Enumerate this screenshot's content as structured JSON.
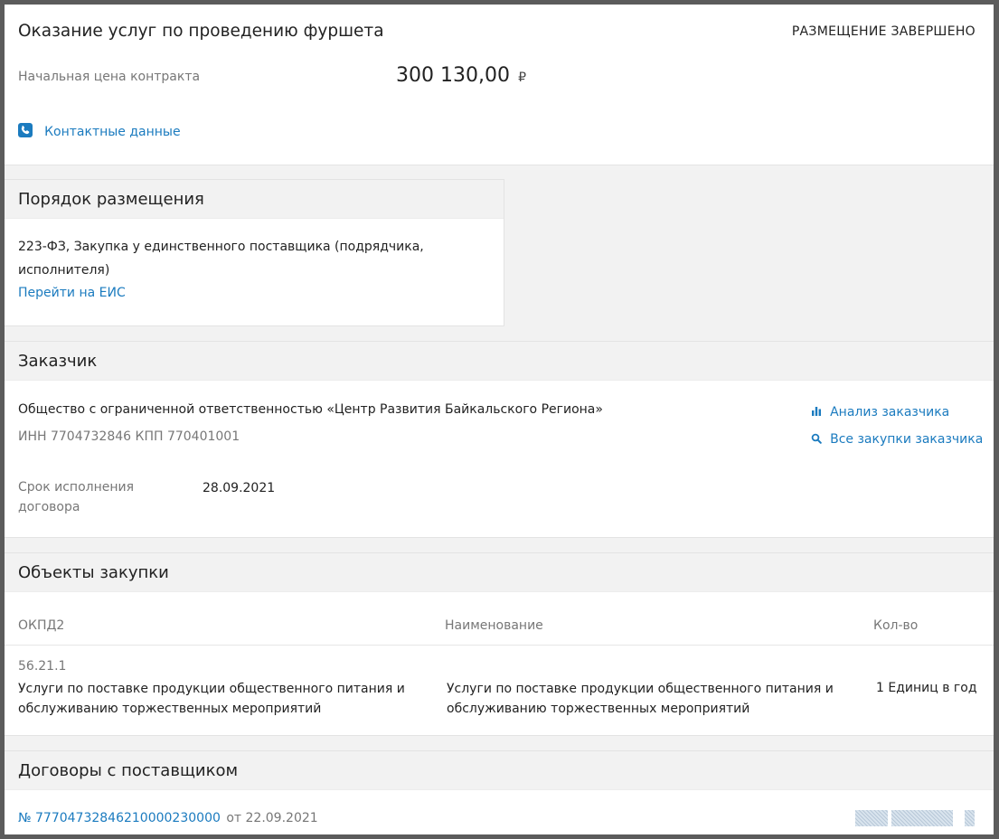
{
  "header": {
    "title": "Оказание услуг по проведению фуршета",
    "status": "РАЗМЕЩЕНИЕ ЗАВЕРШЕНО",
    "price_label": "Начальная цена контракта",
    "price_value": "300 130,00",
    "currency": "₽",
    "contacts_link": "Контактные данные",
    "contacts_icon": "phone-icon"
  },
  "procedure": {
    "title": "Порядок размещения",
    "text": "223-ФЗ, Закупка у единственного поставщика (подрядчика, исполнителя)",
    "eis_link": "Перейти на ЕИС"
  },
  "customer": {
    "title": "Заказчик",
    "name": "Общество с ограниченной ответственностью «Центр Развития Байкальского Региона»",
    "inn_kpp": "ИНН 7704732846 КПП 770401001",
    "analysis_link": "Анализ заказчика",
    "all_purchases_link": "Все закупки заказчика",
    "deadline_label": "Срок исполнения договора",
    "deadline_value": "28.09.2021"
  },
  "objects": {
    "title": "Объекты закупки",
    "columns": [
      "ОКПД2",
      "Наименование",
      "Кол-во"
    ],
    "rows": [
      {
        "code": "56.21.1",
        "code_name": "Услуги по поставке продукции общественного питания и обслуживанию торжественных мероприятий",
        "name": "Услуги по поставке продукции общественного питания и обслуживанию торжественных мероприятий",
        "qty": "1 Единиц в год"
      }
    ]
  },
  "contracts": {
    "title": "Договоры с поставщиком",
    "items": [
      {
        "number": "№ 77704732846210000230000",
        "date": "от 22.09.2021"
      }
    ]
  },
  "colors": {
    "link": "#1b7bbf",
    "muted": "#777777",
    "section_bg": "#f2f2f2",
    "frame": "#5c5c5c"
  }
}
